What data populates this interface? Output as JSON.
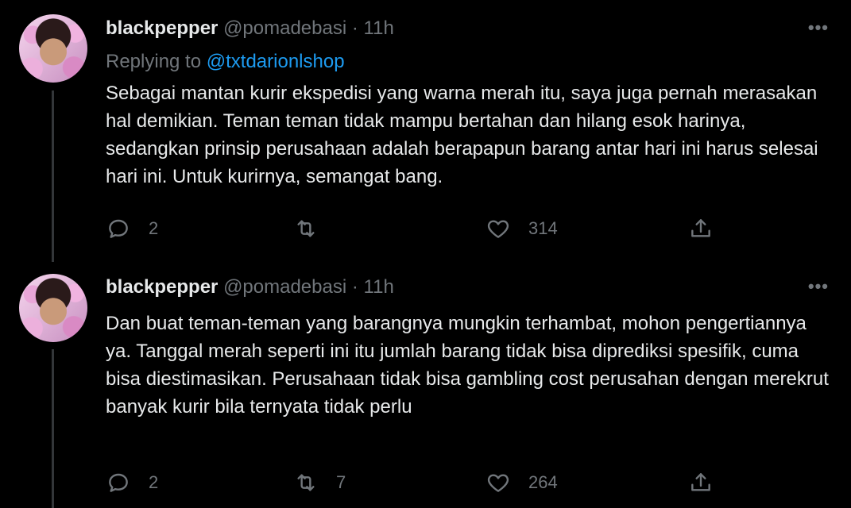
{
  "tweets": [
    {
      "display_name": "blackpepper",
      "handle": "@pomadebasi",
      "separator": "·",
      "time": "11h",
      "more": "•••",
      "replying_prefix": "Replying to",
      "replying_to": "@txtdarionlshop",
      "text": "Sebagai mantan kurir ekspedisi yang warna merah itu, saya juga pernah merasakan hal demikian. Teman teman tidak mampu bertahan dan hilang esok harinya, sedangkan prinsip perusahaan adalah berapapun barang antar hari ini harus selesai hari ini. Untuk kurirnya, semangat bang.",
      "replies": "2",
      "retweets": "",
      "likes": "314"
    },
    {
      "display_name": "blackpepper",
      "handle": "@pomadebasi",
      "separator": "·",
      "time": "11h",
      "more": "•••",
      "text": "Dan buat teman-teman yang barangnya mungkin terhambat, mohon pengertiannya ya. Tanggal merah seperti ini itu jumlah barang tidak bisa diprediksi spesifik, cuma bisa diestimasikan. Perusahaan tidak bisa gambling cost perusahan dengan merekrut banyak kurir bila ternyata tidak perlu",
      "replies": "2",
      "retweets": "7",
      "likes": "264"
    }
  ],
  "icons": {
    "reply": "reply-icon",
    "retweet": "retweet-icon",
    "like": "heart-icon",
    "share": "share-icon",
    "more": "more-icon"
  },
  "colors": {
    "background": "#000000",
    "text": "#e7e9ea",
    "secondary": "#71767b",
    "link": "#1d9bf0"
  }
}
